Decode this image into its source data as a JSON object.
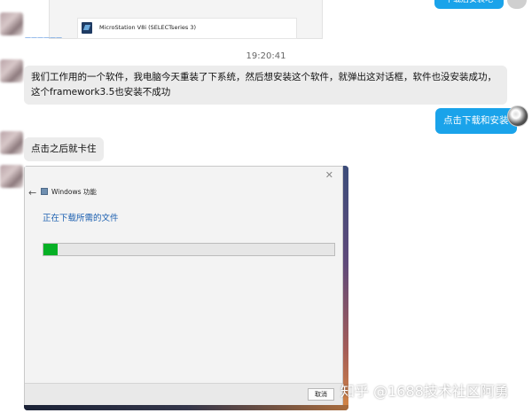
{
  "top_image": {
    "app_name": "MicroStation V8i (SELECTseries 3)",
    "link_text": "——————"
  },
  "top_right_bubble": {
    "text": "下载后安装吧"
  },
  "timestamp": "19:20:41",
  "messages": [
    {
      "side": "left",
      "text": "我们工作用的一个软件，我电脑今天重装了下系统，然后想安装这个软件，就弹出这对话框，软件也没安装成功，这个framework3.5也安装不成功"
    },
    {
      "side": "right",
      "text": "点击下载和安装"
    },
    {
      "side": "left",
      "text": "点击之后就卡住"
    }
  ],
  "dialog": {
    "window_title": "Windows 功能",
    "heading": "正在下载所需的文件",
    "progress_fraction": 0.05,
    "cancel_label": "取消",
    "close_glyph": "✕",
    "back_glyph": "←"
  },
  "watermark": "知乎 @1688技术社区阿勇",
  "colors": {
    "accent_blue": "#1aa3ea",
    "progress_green": "#06b025",
    "heading_blue": "#1b5fb0"
  }
}
